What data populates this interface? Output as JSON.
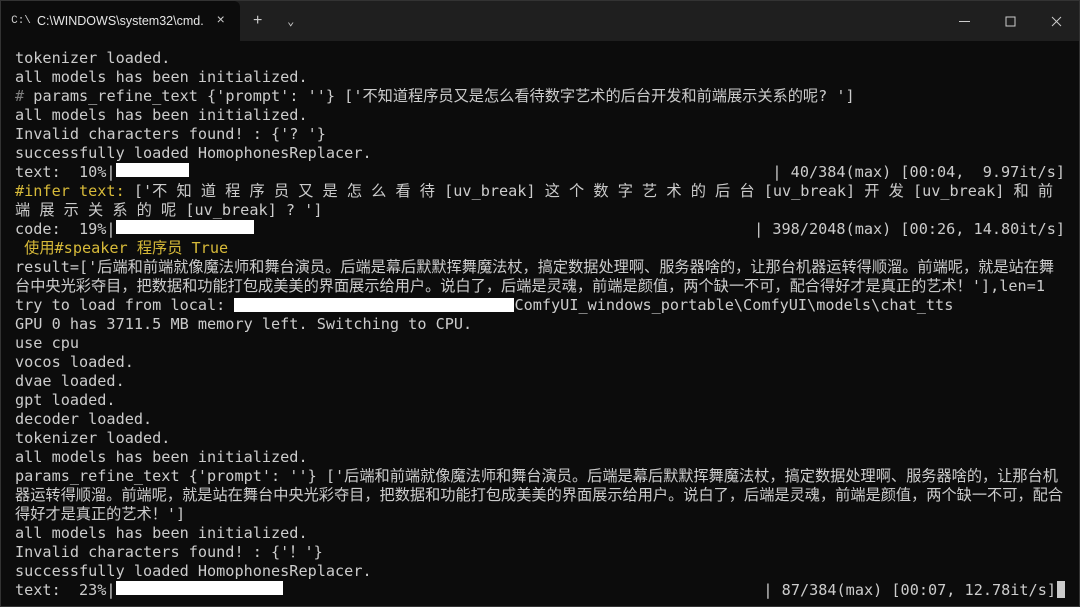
{
  "titlebar": {
    "tab_title": "C:\\WINDOWS\\system32\\cmd.",
    "tab_icon_glyph": "C:\\",
    "close_glyph": "×",
    "new_tab_glyph": "+",
    "chevron_glyph": "⌄"
  },
  "terminal": {
    "l01": "tokenizer loaded.",
    "l02": "all models has been initialized.",
    "l03_pre": "# ",
    "l03": "params_refine_text {'prompt': ''} ['不知道程序员又是怎么看待数字艺术的后台开发和前端展示关系的呢? ']",
    "l04": "all models has been initialized.",
    "l05": "Invalid characters found! : {'? '}",
    "l06": "successfully loaded HomophonesReplacer.",
    "prog1_lead": "text:  10%|",
    "prog1_tail": "| 40/384(max) [00:04,  9.97it/s]",
    "prog1_pct": 10,
    "l08a": "#infer text:",
    "l08b": " ['不 知 道 程 序 员 又 是 怎 么 看 待 [uv_break] 这 个 数 字 艺 术 的 后 台 [uv_break] 开 发 [uv_break] 和 前 端 展 示 关 系 的 呢 [uv_break] ? ']",
    "prog2_lead": "code:  19%|",
    "prog2_tail": "| 398/2048(max) [00:26, 14.80it/s]",
    "prog2_pct": 19,
    "l10": " 使用#speaker 程序员 True",
    "l11": "result=['后端和前端就像魔法师和舞台演员。后端是幕后默默挥舞魔法杖，搞定数据处理啊、服务器啥的，让那台机器运转得顺溜。前端呢，就是站在舞台中央光彩夺目，把数据和功能打包成美美的界面展示给用户。说白了，后端是灵魂，前端是颜值，两个缺一不可，配合得好才是真正的艺术！'],len=1",
    "l12a": "try to load from local: ",
    "l12b": "ComfyUI_windows_portable\\ComfyUI\\models\\chat_tts",
    "l13": "GPU 0 has 3711.5 MB memory left. Switching to CPU.",
    "l14": "use cpu",
    "l15": "vocos loaded.",
    "l16": "dvae loaded.",
    "l17": "gpt loaded.",
    "l18": "decoder loaded.",
    "l19": "tokenizer loaded.",
    "l20": "all models has been initialized.",
    "l21": "params_refine_text {'prompt': ''} ['后端和前端就像魔法师和舞台演员。后端是幕后默默挥舞魔法杖，搞定数据处理啊、服务器啥的，让那台机器运转得顺溜。前端呢，就是站在舞台中央光彩夺目，把数据和功能打包成美美的界面展示给用户。说白了，后端是灵魂，前端是颜值，两个缺一不可，配合得好才是真正的艺术！']",
    "l22": "all models has been initialized.",
    "l23": "Invalid characters found! : {'！'}",
    "l24": "successfully loaded HomophonesReplacer.",
    "prog3_lead": "text:  23%|",
    "prog3_tail": "| 87/384(max) [00:07, 12.78it/s]",
    "prog3_pct": 23
  }
}
